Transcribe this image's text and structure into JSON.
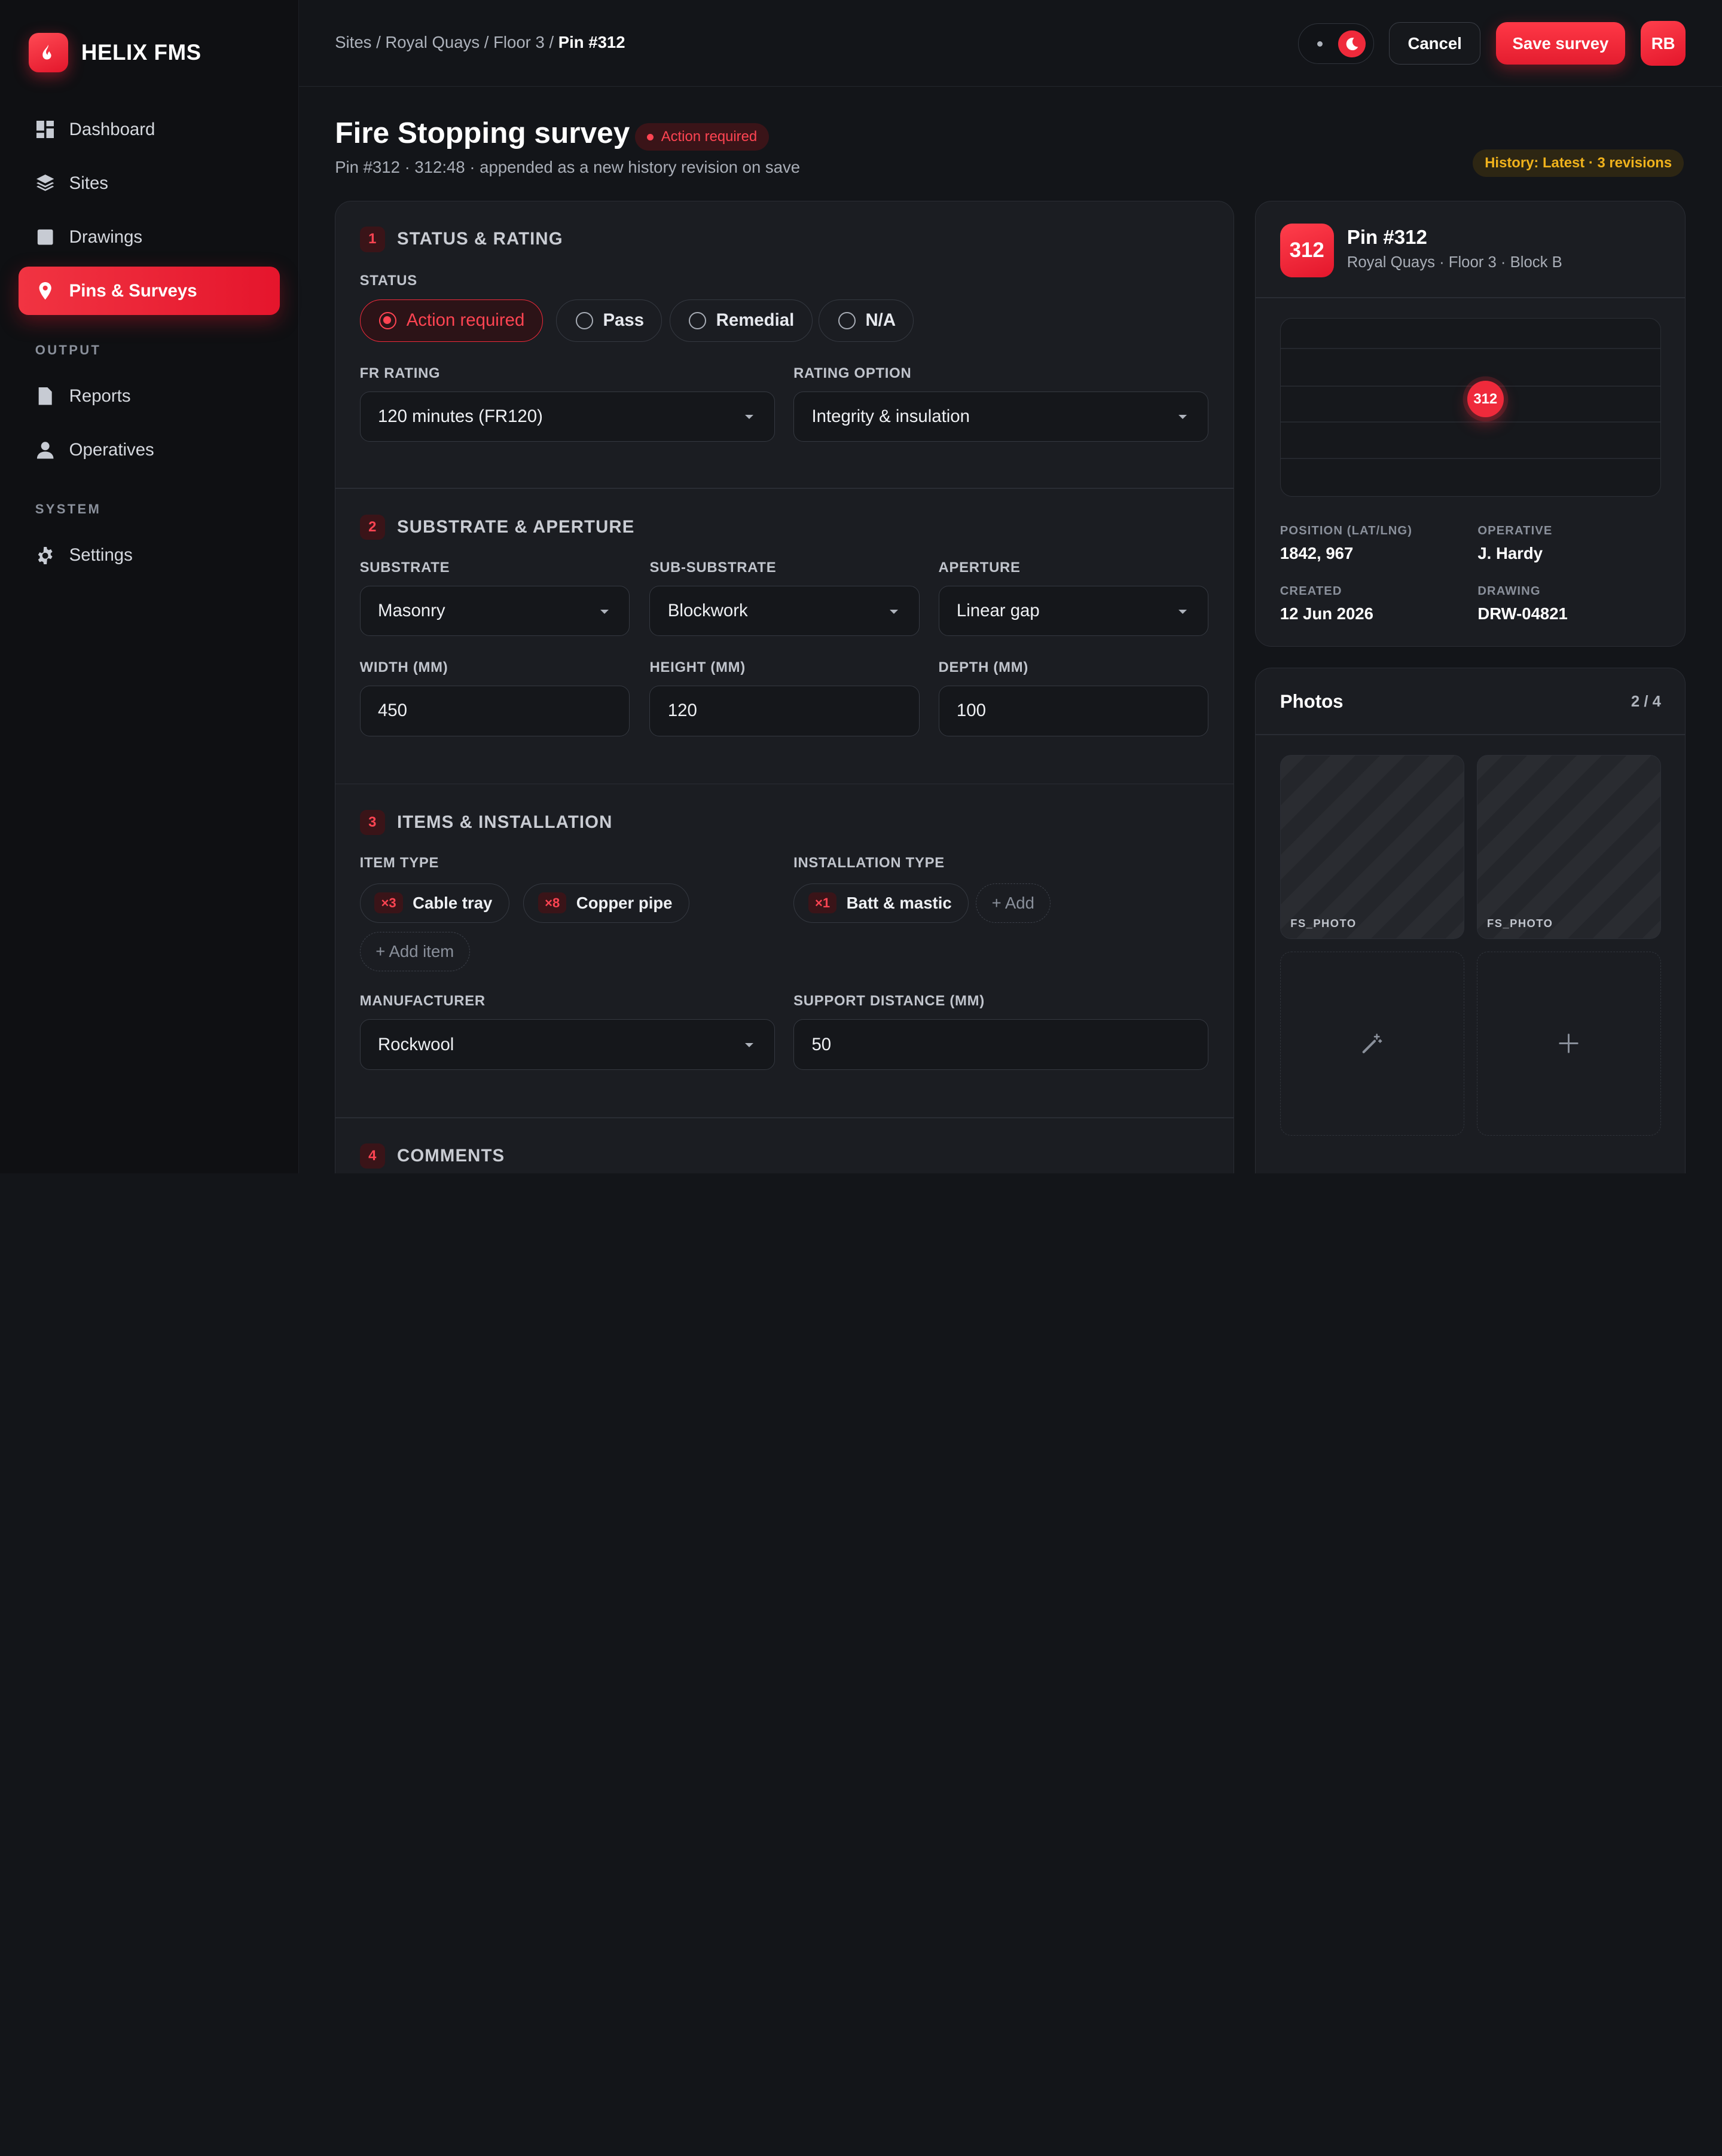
{
  "app": {
    "name": "HELIX FMS"
  },
  "sidebar": {
    "items": [
      {
        "label": "Dashboard",
        "icon": "dashboard-icon"
      },
      {
        "label": "Sites",
        "icon": "layers-icon"
      },
      {
        "label": "Drawings",
        "icon": "square-icon"
      },
      {
        "label": "Pins & Surveys",
        "icon": "pin-icon",
        "active": true
      }
    ],
    "output_label": "OUTPUT",
    "output_items": [
      {
        "label": "Reports",
        "icon": "document-icon"
      },
      {
        "label": "Operatives",
        "icon": "user-icon"
      }
    ],
    "system_label": "SYSTEM",
    "system_items": [
      {
        "label": "Settings",
        "icon": "gear-icon"
      }
    ]
  },
  "topbar": {
    "breadcrumb": [
      "Sites",
      "Royal Quays",
      "Floor 3",
      "Pin #312"
    ],
    "cancel_label": "Cancel",
    "save_label": "Save survey",
    "avatar_initials": "RB"
  },
  "page": {
    "title": "Fire Stopping survey",
    "status_badge": "Action required",
    "subtitle": "Pin #312 · 312:48 · appended as a new history revision on save",
    "history_badge": "History: Latest · 3 revisions"
  },
  "sections": {
    "s1": {
      "num": "1",
      "title": "STATUS & RATING",
      "status_label": "STATUS",
      "status_options": [
        "Action required",
        "Pass",
        "Remedial",
        "N/A"
      ],
      "status_selected": "Action required",
      "fr_label": "FR RATING",
      "fr_value": "120 minutes (FR120)",
      "rating_label": "RATING OPTION",
      "rating_value": "Integrity & insulation"
    },
    "s2": {
      "num": "2",
      "title": "SUBSTRATE & APERTURE",
      "substrate_label": "SUBSTRATE",
      "substrate_value": "Masonry",
      "subsub_label": "SUB-SUBSTRATE",
      "subsub_value": "Blockwork",
      "aperture_label": "APERTURE",
      "aperture_value": "Linear gap",
      "width_label": "WIDTH (MM)",
      "width_value": "450",
      "height_label": "HEIGHT (MM)",
      "height_value": "120",
      "depth_label": "DEPTH (MM)",
      "depth_value": "100"
    },
    "s3": {
      "num": "3",
      "title": "ITEMS & INSTALLATION",
      "item_type_label": "ITEM TYPE",
      "items": [
        {
          "qty": "×3",
          "label": "Cable tray"
        },
        {
          "qty": "×8",
          "label": "Copper pipe"
        }
      ],
      "add_item_label": "+ Add item",
      "install_label": "INSTALLATION TYPE",
      "installs": [
        {
          "qty": "×1",
          "label": "Batt & mastic"
        }
      ],
      "add_install_label": "+ Add",
      "manufacturer_label": "MANUFACTURER",
      "manufacturer_value": "Rockwool",
      "support_label": "SUPPORT DISTANCE (MM)",
      "support_value": "50"
    },
    "s4": {
      "num": "4",
      "title": "COMMENTS"
    }
  },
  "pin": {
    "number": "312",
    "title": "Pin #312",
    "location": "Royal Quays · Floor 3 · Block B",
    "position_label": "POSITION (LAT/LNG)",
    "position_value": "1842, 967",
    "operative_label": "OPERATIVE",
    "operative_value": "J. Hardy",
    "created_label": "CREATED",
    "created_value": "12 Jun 2026",
    "drawing_label": "DRAWING",
    "drawing_value": "DRW-04821"
  },
  "photos": {
    "title": "Photos",
    "count": "2 / 4",
    "tags": [
      "FS_PHOTO",
      "FS_PHOTO"
    ]
  },
  "colors": {
    "accent": "#ef2a3b",
    "warning": "#f0b21c",
    "background": "#131519",
    "surface": "#1b1d22"
  }
}
